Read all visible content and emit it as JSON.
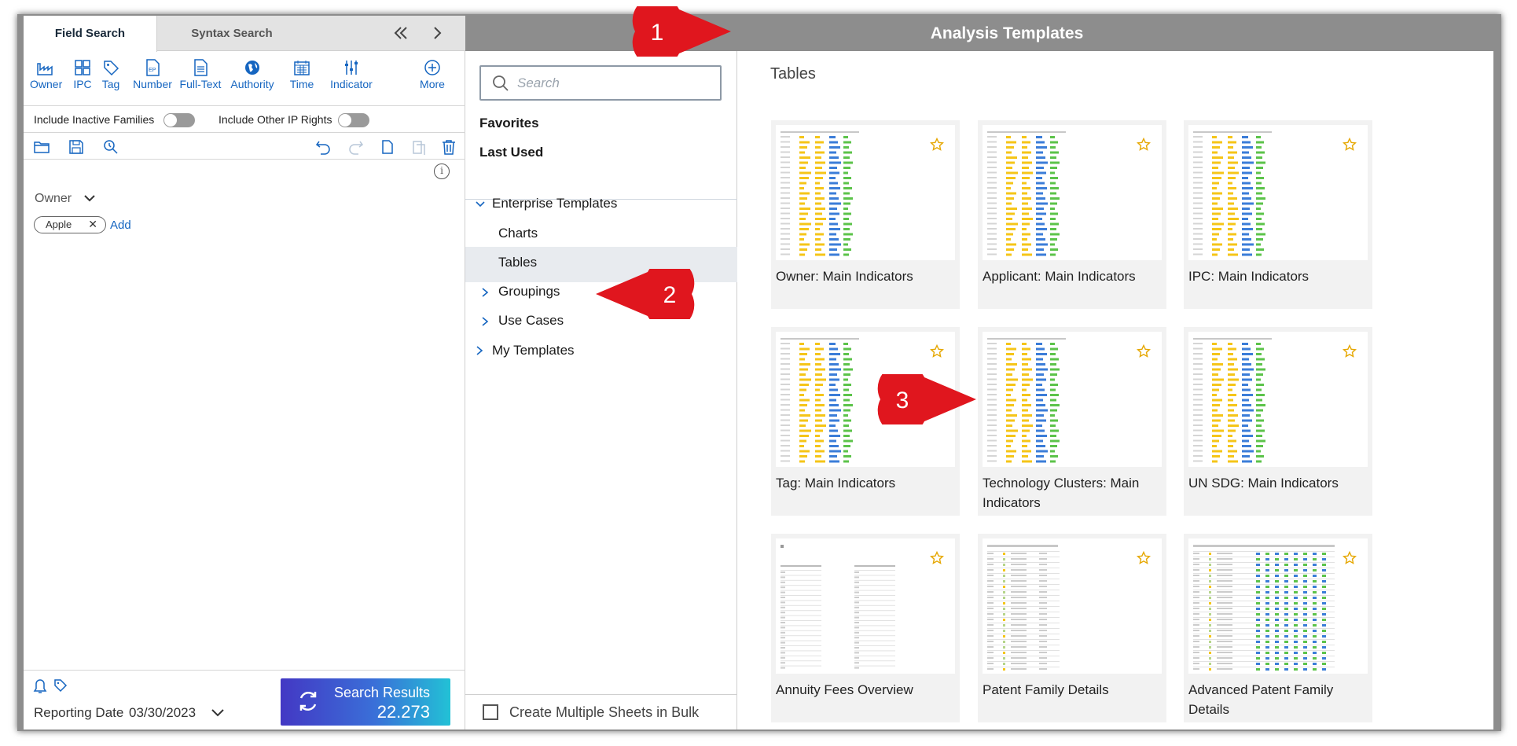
{
  "tabs": {
    "field_search": "Field Search",
    "syntax_search": "Syntax Search"
  },
  "tools": [
    {
      "label": "Owner",
      "icon": "factory-icon"
    },
    {
      "label": "IPC",
      "icon": "grid-icon"
    },
    {
      "label": "Tag",
      "icon": "tag-icon"
    },
    {
      "label": "Number",
      "icon": "ep-document-icon"
    },
    {
      "label": "Full-Text",
      "icon": "document-icon"
    },
    {
      "label": "Authority",
      "icon": "globe-icon"
    },
    {
      "label": "Time",
      "icon": "calendar-icon"
    },
    {
      "label": "Indicator",
      "icon": "sliders-icon"
    },
    {
      "label": "More",
      "icon": "plus-circle-icon"
    }
  ],
  "toggles": {
    "inactive_families": "Include Inactive Families",
    "other_ip_rights": "Include Other IP Rights"
  },
  "criteria": {
    "field_label": "Owner",
    "chip_value": "Apple",
    "chip_remove": "✕",
    "add_label": "Add"
  },
  "footer": {
    "reporting_label": "Reporting Date",
    "reporting_date": "03/30/2023",
    "search_results_label": "Search Results",
    "search_results_count": "22.273"
  },
  "middle": {
    "search_placeholder": "Search",
    "favorites": "Favorites",
    "last_used": "Last Used",
    "enterprise_templates": "Enterprise Templates",
    "charts": "Charts",
    "tables": "Tables",
    "groupings": "Groupings",
    "use_cases": "Use Cases",
    "my_templates": "My Templates",
    "bulk_label": "Create Multiple Sheets in Bulk"
  },
  "header": {
    "title": "Analysis Templates"
  },
  "right": {
    "section_title": "Tables",
    "cards": [
      {
        "title": "Owner: Main Indicators",
        "style": "indicators"
      },
      {
        "title": "Applicant: Main Indicators",
        "style": "indicators"
      },
      {
        "title": "IPC: Main Indicators",
        "style": "indicators"
      },
      {
        "title": "Tag: Main Indicators",
        "style": "indicators"
      },
      {
        "title": "Technology Clusters: Main Indicators",
        "style": "indicators"
      },
      {
        "title": "UN SDG: Main Indicators",
        "style": "indicators"
      },
      {
        "title": "Annuity Fees Overview",
        "style": "annuity"
      },
      {
        "title": "Patent Family Details",
        "style": "family"
      },
      {
        "title": "Advanced Patent Family Details",
        "style": "advanced"
      }
    ]
  },
  "badges": [
    "1",
    "2",
    "3"
  ],
  "colors": {
    "accent": "#1565c0",
    "badge": "#e0161e",
    "header": "#8d8d8d",
    "yellow": "#f5c518",
    "blue": "#3b7dd8",
    "green": "#5cc34a"
  }
}
